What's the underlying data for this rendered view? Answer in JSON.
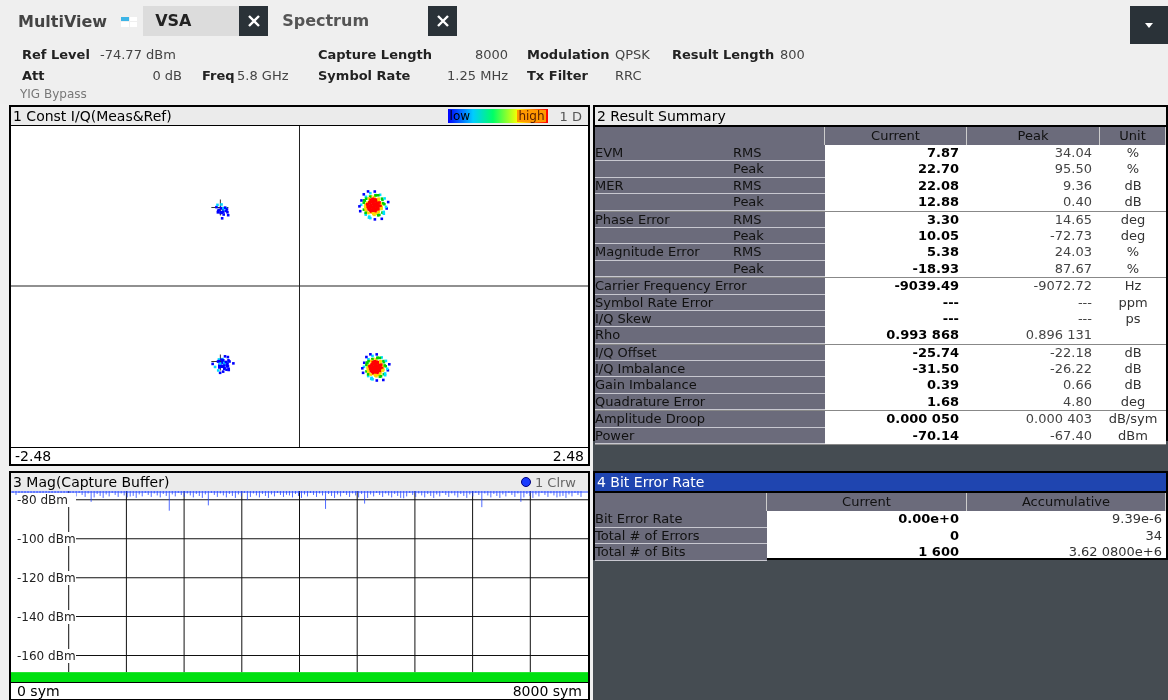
{
  "tabs_bar": {
    "title": "MultiView",
    "tabs": [
      {
        "label": "VSA",
        "selected": true
      },
      {
        "label": "Spectrum",
        "selected": false
      }
    ]
  },
  "header": {
    "rows": [
      [
        {
          "label": "Ref Level",
          "value": "-74.77 dBm"
        },
        {},
        {
          "label": "Capture Length",
          "value": "8000"
        },
        {
          "label": "Modulation",
          "value": "QPSK"
        },
        {
          "label": "Result Length",
          "value": "800"
        }
      ],
      [
        {
          "label": "Att",
          "value": "0 dB"
        },
        {
          "label": "Freq",
          "value": "5.8 GHz"
        },
        {
          "label": "Symbol Rate",
          "value": "1.25 MHz"
        },
        {
          "label": "Tx Filter",
          "value": "RRC"
        }
      ]
    ],
    "note": "YIG Bypass"
  },
  "const_panel": {
    "title": "1 Const I/Q(Meas&Ref)",
    "selected": false,
    "legend_low": "low",
    "legend_high": "high",
    "trace": "1 D",
    "x_min": "-2.48",
    "x_max": "2.48"
  },
  "result_summary": {
    "title": "2 Result Summary",
    "selected": false,
    "columns": [
      "Current",
      "Peak",
      "Unit"
    ],
    "groups": [
      {
        "rows": [
          {
            "label": "EVM",
            "sub": "RMS",
            "current": "7.87",
            "peak": "34.04",
            "unit": "%"
          },
          {
            "sub": "Peak",
            "current": "22.70",
            "peak": "95.50",
            "unit": "%"
          },
          {
            "label": "MER",
            "sub": "RMS",
            "current": "22.08",
            "peak": "9.36",
            "unit": "dB"
          },
          {
            "sub": "Peak",
            "current": "12.88",
            "peak": "0.40",
            "unit": "dB"
          }
        ]
      },
      {
        "rows": [
          {
            "label": "Phase Error",
            "sub": "RMS",
            "current": "3.30",
            "peak": "14.65",
            "unit": "deg"
          },
          {
            "sub": "Peak",
            "current": "10.05",
            "peak": "-72.73",
            "unit": "deg"
          },
          {
            "label": "Magnitude Error",
            "sub": "RMS",
            "current": "5.38",
            "peak": "24.03",
            "unit": "%"
          },
          {
            "sub": "Peak",
            "current": "-18.93",
            "peak": "87.67",
            "unit": "%"
          }
        ]
      },
      {
        "rows": [
          {
            "label": "Carrier Frequency Error",
            "current": "-9039.49",
            "peak": "-9072.72",
            "unit": "Hz"
          },
          {
            "label": "Symbol Rate Error",
            "current": "---",
            "peak": "---",
            "unit": "ppm"
          },
          {
            "label": "I/Q Skew",
            "current": "---",
            "peak": "---",
            "unit": "ps"
          },
          {
            "label": "Rho",
            "current": "0.993 868",
            "peak": "0.896 131"
          }
        ]
      },
      {
        "rows": [
          {
            "label": "I/Q Offset",
            "current": "-25.74",
            "peak": "-22.18",
            "unit": "dB"
          },
          {
            "label": "I/Q Imbalance",
            "current": "-31.50",
            "peak": "-26.22",
            "unit": "dB"
          },
          {
            "label": "Gain Imbalance",
            "current": "0.39",
            "peak": "0.66",
            "unit": "dB"
          },
          {
            "label": "Quadrature Error",
            "current": "1.68",
            "peak": "4.80",
            "unit": "deg"
          }
        ]
      },
      {
        "rows": [
          {
            "label": "Amplitude Droop",
            "current": "0.000 050",
            "peak": "0.000 403",
            "unit": "dB/sym"
          },
          {
            "label": "Power",
            "current": "-70.14",
            "peak": "-67.40",
            "unit": "dBm"
          }
        ]
      }
    ]
  },
  "mag_panel": {
    "title": "3 Mag(Capture Buffer)",
    "selected": false,
    "trace": "1 Clrw",
    "y_labels": [
      "-80 dBm",
      "-100 dBm",
      "-120 dBm",
      "-140 dBm",
      "-160 dBm"
    ],
    "x_start": "0 sym",
    "x_end": "8000 sym"
  },
  "ber": {
    "title": "4 Bit Error Rate",
    "selected": true,
    "columns": [
      "Current",
      "Accumulative"
    ],
    "rows": [
      {
        "label": "Bit Error Rate",
        "current": "0.00e+0",
        "accumulative": "9.39e-6"
      },
      {
        "label": "Total # of Errors",
        "current": "0",
        "accumulative": "34"
      },
      {
        "label": "Total # of Bits",
        "current": "1 600",
        "accumulative": "3.62 0800e+6"
      }
    ]
  }
}
